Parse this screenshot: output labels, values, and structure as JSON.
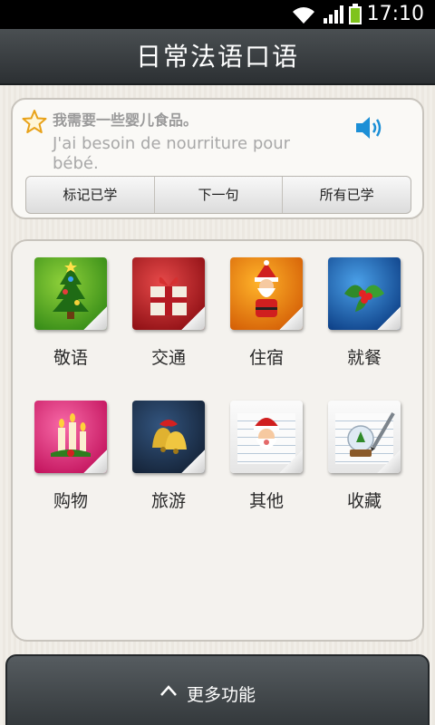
{
  "status_bar": {
    "time": "17:10",
    "icons": [
      "wifi-icon",
      "signal-icon",
      "battery-icon"
    ],
    "battery_color": "#7fc31c"
  },
  "header": {
    "title": "日常法语口语"
  },
  "phrase": {
    "chinese": "我需要一些婴儿食品。",
    "french": "J'ai besoin de nourriture pour bébé.",
    "icons": [
      "star-icon",
      "speaker-icon"
    ]
  },
  "actions": {
    "mark_learned": "标记已学",
    "next_sentence": "下一句",
    "all_learned": "所有已学"
  },
  "categories": [
    {
      "label": "敬语",
      "icon": "christmas-tree-icon",
      "color": "#5aab24"
    },
    {
      "label": "交通",
      "icon": "gift-box-icon",
      "color": "#c0171f"
    },
    {
      "label": "住宿",
      "icon": "santa-icon",
      "color": "#f08a12"
    },
    {
      "label": "就餐",
      "icon": "holly-icon",
      "color": "#1e63b8"
    },
    {
      "label": "购物",
      "icon": "candles-icon",
      "color": "#e23283"
    },
    {
      "label": "旅游",
      "icon": "bells-icon",
      "color": "#1f3452"
    },
    {
      "label": "其他",
      "icon": "notepad-santa-icon",
      "color": "#eeeeee"
    },
    {
      "label": "收藏",
      "icon": "notepad-snowglobe-icon",
      "color": "#eeeeee"
    }
  ],
  "footer": {
    "more_label": "更多功能"
  }
}
